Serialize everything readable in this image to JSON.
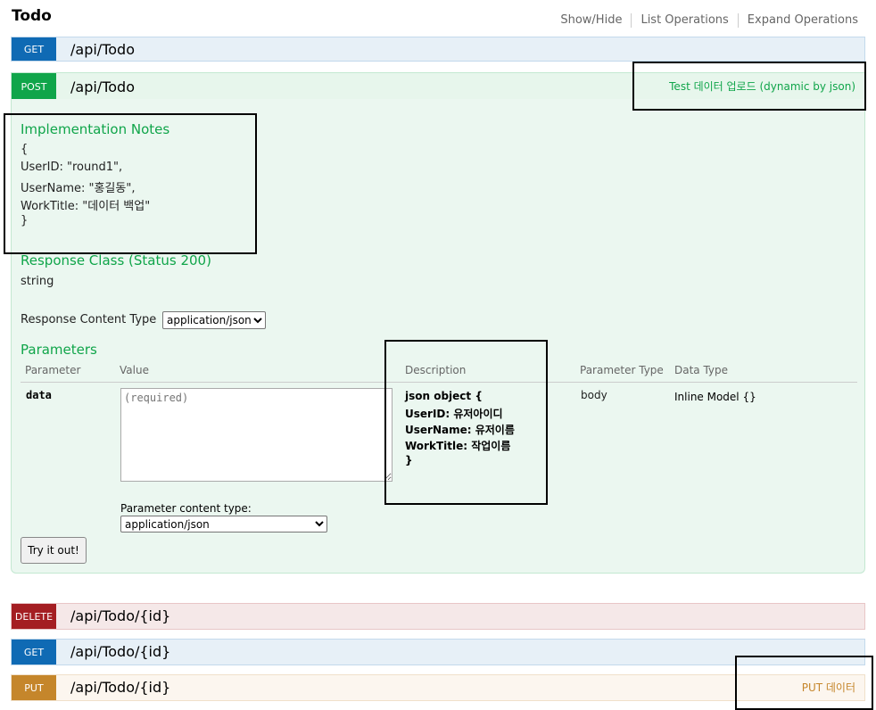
{
  "resource": {
    "title": "Todo"
  },
  "top_links": [
    "Show/Hide",
    "List Operations",
    "Expand Operations"
  ],
  "ops": [
    {
      "method": "GET",
      "path": "/api/Todo",
      "summary": ""
    },
    {
      "method": "POST",
      "path": "/api/Todo",
      "summary": "Test 데이터 업로드 (dynamic by json)"
    },
    {
      "method": "DELETE",
      "path": "/api/Todo/{id}",
      "summary": ""
    },
    {
      "method": "GET",
      "path": "/api/Todo/{id}",
      "summary": ""
    },
    {
      "method": "PUT",
      "path": "/api/Todo/{id}",
      "summary": "PUT 데이터"
    }
  ],
  "post": {
    "impl_heading": "Implementation Notes",
    "impl_notes": [
      "{",
      "UserID: \"round1\",",
      "UserName: \"홍길동\",",
      "WorkTitle: \"데이터 백업\"",
      "}"
    ],
    "response_class_heading": "Response Class (Status 200)",
    "response_class_value": "string",
    "response_content_type_label": "Response Content Type",
    "response_content_type_value": "application/json",
    "parameters_heading": "Parameters",
    "param_headers": [
      "Parameter",
      "Value",
      "Description",
      "Parameter Type",
      "Data Type"
    ],
    "param": {
      "name": "data",
      "placeholder": "(required)",
      "description": [
        "json object {",
        "UserID: 유저아이디",
        "UserName: 유저이름",
        "WorkTitle: 작업이름",
        "}"
      ],
      "param_type": "body",
      "data_type": "Inline Model {}"
    },
    "param_content_type_label": "Parameter content type:",
    "param_content_type_value": "application/json",
    "try_button": "Try it out!"
  },
  "colors": {
    "get": "#0f6ab4",
    "post": "#10a54a",
    "delete": "#a41e22",
    "put": "#c5862b"
  }
}
